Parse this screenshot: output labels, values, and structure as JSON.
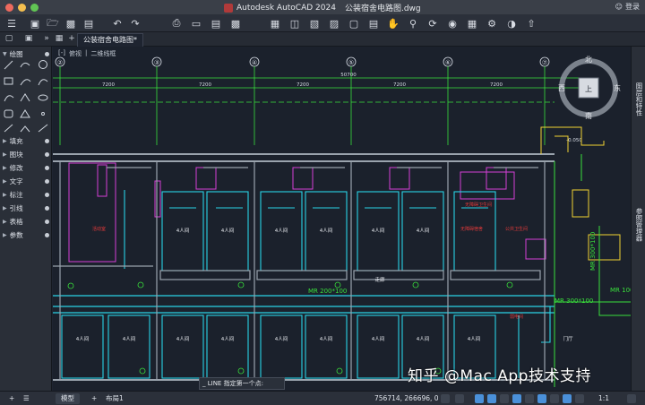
{
  "window": {
    "app_title": "Autodesk AutoCAD 2024",
    "file_name": "公装宿舍电路图.dwg",
    "login_label": "登录"
  },
  "toolbar": {
    "icons": [
      "menu-icon",
      "new-icon",
      "open-icon",
      "save-icon",
      "saveas-icon",
      "undo-icon",
      "redo-icon",
      "print-icon",
      "plot-icon",
      "publish-icon",
      "pan-icon",
      "zoom-icon",
      "orbit-icon",
      "layout-icon",
      "share-icon"
    ]
  },
  "tabs": {
    "document_tab": "公装宿舍电路图*",
    "add_tab": "+"
  },
  "viewport": {
    "view_label": "俯视",
    "style_label": "二维线框",
    "compass": {
      "north": "北",
      "south": "南",
      "east": "东",
      "west": "西",
      "center": "上"
    }
  },
  "drawing": {
    "grid_labels": [
      "②",
      "③",
      "④",
      "⑤",
      "⑥",
      "⑦"
    ],
    "dims": [
      "7200",
      "7200",
      "7200",
      "7200",
      "7200"
    ],
    "total_dim": "50700",
    "level": "-0.050",
    "room_label": "4人间",
    "room_labels_misc": [
      "走廊",
      "无障碍卫生间",
      "无障碍宿舍",
      "公共卫生间",
      "活动室",
      "MR 300*100",
      "MR 200*100",
      "MR 100*",
      "门厅",
      "弱电间",
      "强电井"
    ]
  },
  "left_panel": {
    "top_section": "绘图",
    "sections": [
      "填充",
      "图块",
      "修改",
      "文字",
      "标注",
      "引线",
      "表格",
      "参数"
    ]
  },
  "right_panel": {
    "items": [
      "图层和特性",
      "参照管理器"
    ]
  },
  "bottom": {
    "model_tab": "模型",
    "layout_tab": "布局1",
    "add_layout": "+",
    "command_prompt": "_ LINE 指定第一个点:",
    "coordinates": "756714, 266696, 0",
    "scale": "1:1"
  },
  "watermark": "知乎 @Mac App技术支持",
  "colors": {
    "cyan": "#29d3e6",
    "green": "#39e03b",
    "magenta": "#d640d6",
    "yellow": "#f2d232",
    "gray": "#9aa3ad",
    "red": "#e53a3a",
    "background": "#1b212c"
  }
}
